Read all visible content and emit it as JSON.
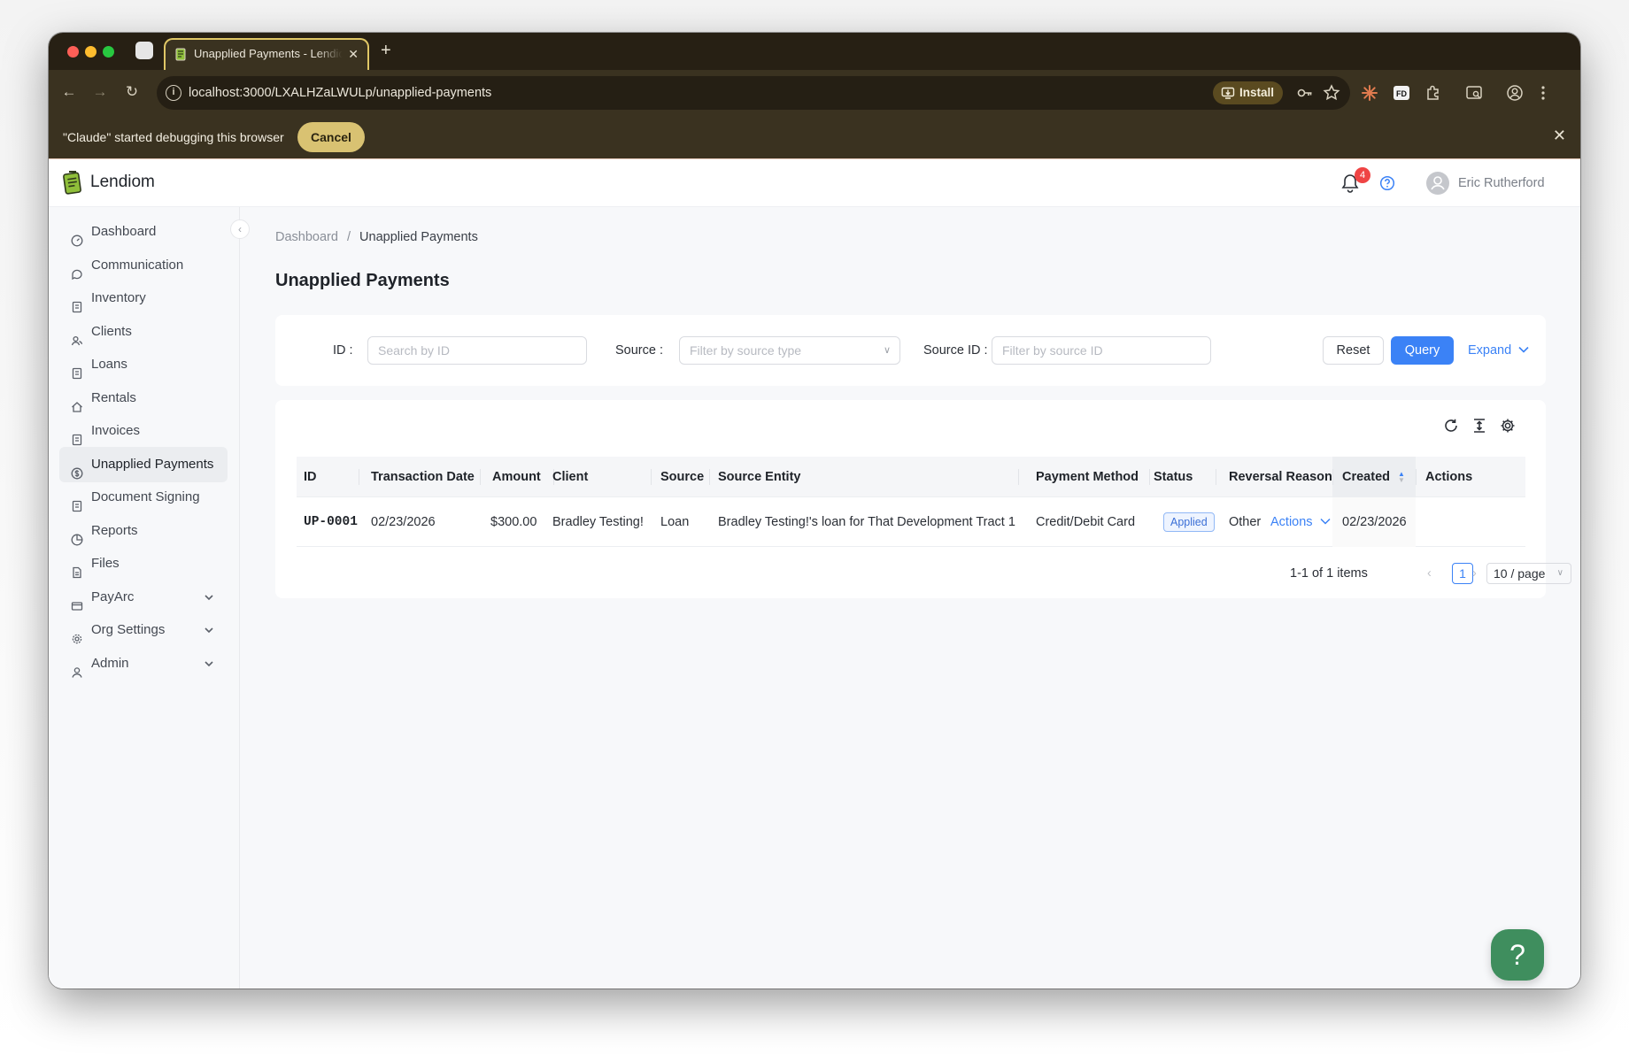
{
  "browser": {
    "tab_title": "Unapplied Payments - Lendiom",
    "tab_close": "✕",
    "new_tab": "+",
    "url": "localhost:3000/LXALHZaLWULp/unapplied-payments",
    "install_label": "Install",
    "debug_message": "\"Claude\" started debugging this browser",
    "debug_cancel": "Cancel",
    "debug_close": "✕"
  },
  "header": {
    "brand": "Lendiom",
    "notification_count": "4",
    "user_name": "Eric Rutherford"
  },
  "sidebar": {
    "collapse": "‹",
    "items": [
      {
        "label": "Dashboard",
        "icon": "dashboard-icon"
      },
      {
        "label": "Communication",
        "icon": "chat-icon"
      },
      {
        "label": "Inventory",
        "icon": "document-icon"
      },
      {
        "label": "Clients",
        "icon": "users-icon"
      },
      {
        "label": "Loans",
        "icon": "document-icon"
      },
      {
        "label": "Rentals",
        "icon": "home-icon"
      },
      {
        "label": "Invoices",
        "icon": "document-icon"
      },
      {
        "label": "Unapplied Payments",
        "icon": "dollar-icon",
        "active": true
      },
      {
        "label": "Document Signing",
        "icon": "document-icon"
      },
      {
        "label": "Reports",
        "icon": "chart-icon"
      },
      {
        "label": "Files",
        "icon": "file-icon"
      },
      {
        "label": "PayArc",
        "icon": "card-icon",
        "expandable": true
      },
      {
        "label": "Org Settings",
        "icon": "gear-icon",
        "expandable": true
      },
      {
        "label": "Admin",
        "icon": "user-icon",
        "expandable": true
      }
    ]
  },
  "breadcrumb": {
    "home": "Dashboard",
    "separator": "/",
    "current": "Unapplied Payments"
  },
  "page_title": "Unapplied Payments",
  "filters": {
    "id_label": "ID :",
    "id_placeholder": "Search by ID",
    "source_label": "Source :",
    "source_placeholder": "Filter by source type",
    "source_id_label": "Source ID :",
    "source_id_placeholder": "Filter by source ID",
    "reset": "Reset",
    "query": "Query",
    "expand": "Expand"
  },
  "table": {
    "columns": [
      "ID",
      "Transaction Date",
      "Amount",
      "Client",
      "Source",
      "Source Entity",
      "Payment Method",
      "Status",
      "Reversal Reason",
      "Created",
      "Actions"
    ],
    "rows": [
      {
        "id": "UP-0001",
        "transaction_date": "02/23/2026",
        "amount": "$300.00",
        "client": "Bradley Testing!",
        "source": "Loan",
        "source_entity": "Bradley Testing!'s loan for That Development Tract 1",
        "payment_method": "Credit/Debit Card",
        "status": "Applied",
        "reversal_reason": "Other",
        "created": "02/23/2026",
        "actions": "Actions"
      }
    ],
    "pagination": {
      "summary": "1-1 of 1 items",
      "current_page": "1",
      "page_size": "10 / page"
    }
  },
  "help_button": "?",
  "colors": {
    "accent": "#3b82f6",
    "browser_chrome": "#3a3220",
    "tab_highlight": "#e0c766",
    "help_fab": "#3f8e5e",
    "badge": "#ef4444"
  }
}
